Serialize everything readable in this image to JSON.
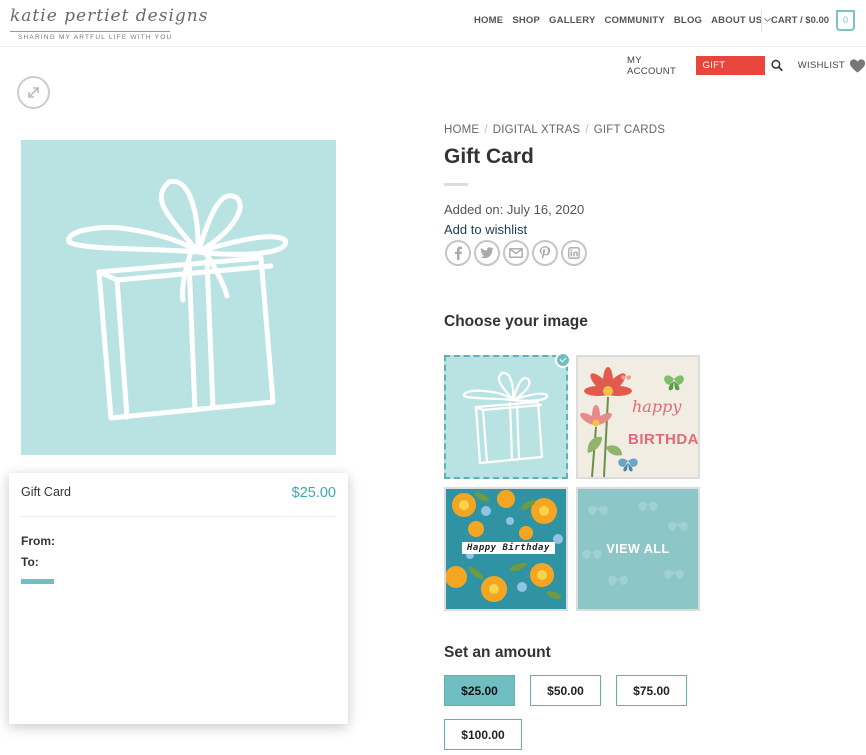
{
  "brand": {
    "logo_text": "katie pertiet designs",
    "tagline": "SHARING MY ARTFUL LIFE WITH YOU"
  },
  "main_nav": {
    "items": [
      "HOME",
      "SHOP",
      "GALLERY",
      "COMMUNITY",
      "BLOG",
      "ABOUT US"
    ],
    "cart_label": "CART / $0.00",
    "cart_count": "0"
  },
  "sub_nav": {
    "my_account": "MY ACCOUNT",
    "gift_cards": "GIFT CARDS",
    "wishlist": "WISHLIST"
  },
  "breadcrumb": [
    "HOME",
    "DIGITAL XTRAS",
    "GIFT CARDS"
  ],
  "product": {
    "title": "Gift Card",
    "added_on": "Added on: July 16, 2020",
    "add_to_wishlist": "Add to wishlist",
    "share_icons": [
      "facebook-icon",
      "twitter-icon",
      "email-icon",
      "pinterest-icon",
      "linkedin-icon"
    ]
  },
  "preview": {
    "title": "Gift Card",
    "price": "$25.00",
    "from_label": "From:",
    "to_label": "To:"
  },
  "choose_image": {
    "heading": "Choose your image",
    "thumbs": [
      {
        "name": "gift-box",
        "selected": true
      },
      {
        "name": "happy-birthday-flowers",
        "text_line1": "happy",
        "text_line2": "BIRTHDAY"
      },
      {
        "name": "happy-birthday-floral",
        "label": "Happy Birthday"
      },
      {
        "name": "view-all",
        "label": "VIEW ALL"
      }
    ]
  },
  "amount": {
    "heading": "Set an amount",
    "options": [
      "$25.00",
      "$50.00",
      "$75.00",
      "$100.00"
    ],
    "selected": "$25.00"
  },
  "colors": {
    "accent_teal": "#6fbec1",
    "gift_card_red": "#e8453c",
    "image_background": "#b9e2e2"
  }
}
